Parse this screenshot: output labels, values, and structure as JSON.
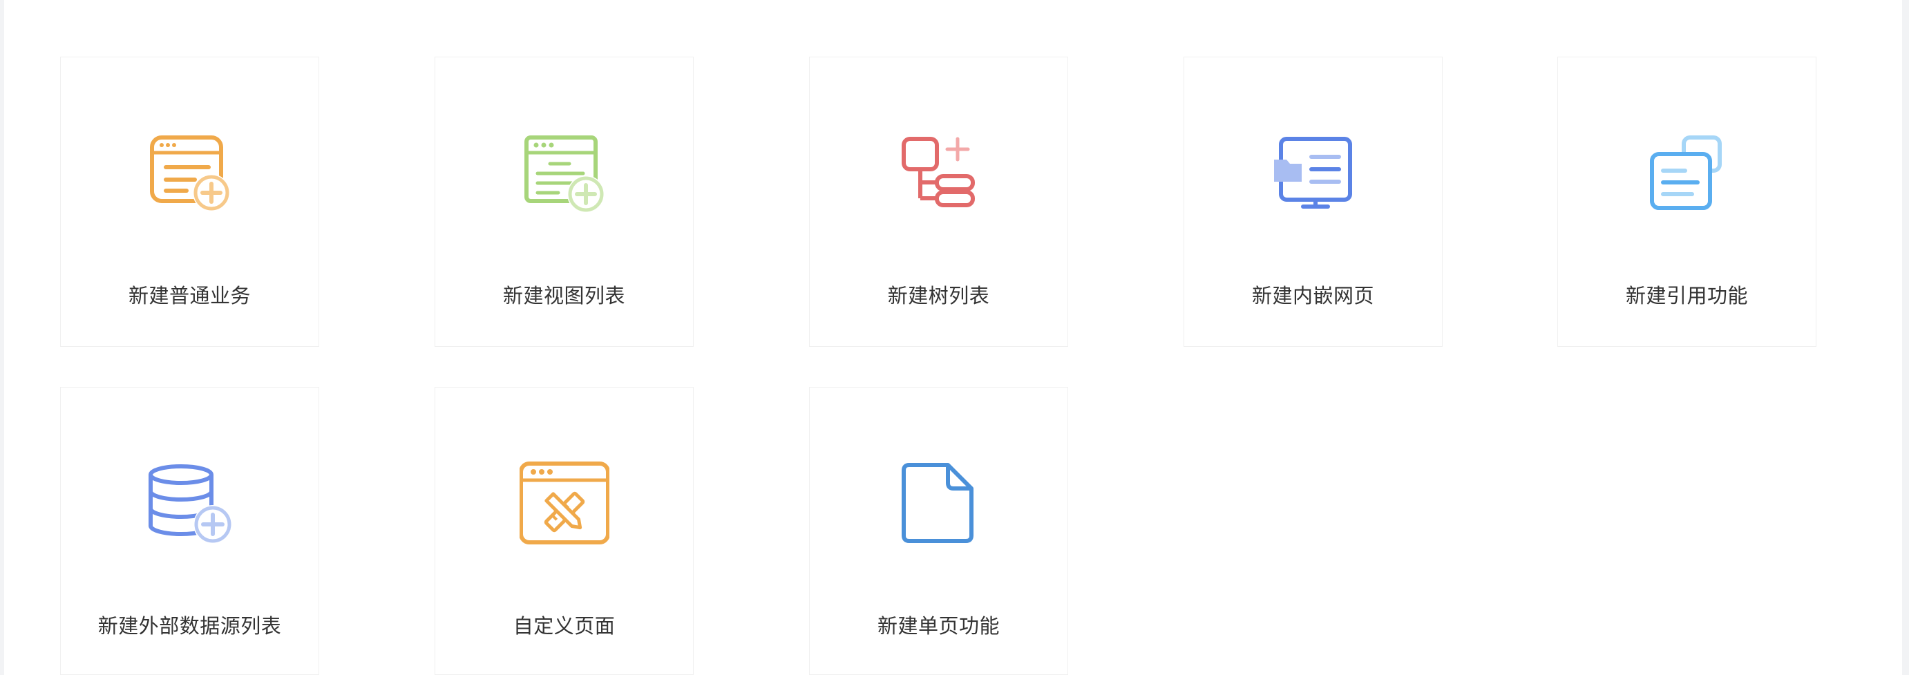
{
  "cards": [
    {
      "label": "新建普通业务",
      "icon": "new-business-icon",
      "color": "#f0a94a"
    },
    {
      "label": "新建视图列表",
      "icon": "new-view-list-icon",
      "color": "#a7d57a"
    },
    {
      "label": "新建树列表",
      "icon": "new-tree-list-icon",
      "color": "#e26a6a"
    },
    {
      "label": "新建内嵌网页",
      "icon": "new-embedded-webpage-icon",
      "color": "#5b83e6"
    },
    {
      "label": "新建引用功能",
      "icon": "new-reference-function-icon",
      "color": "#5aaef0"
    },
    {
      "label": "新建外部数据源列表",
      "icon": "new-external-datasource-icon",
      "color": "#6b8de8"
    },
    {
      "label": "自定义页面",
      "icon": "custom-page-icon",
      "color": "#f0a94a"
    },
    {
      "label": "新建单页功能",
      "icon": "new-single-page-icon",
      "color": "#4a90d9"
    }
  ]
}
